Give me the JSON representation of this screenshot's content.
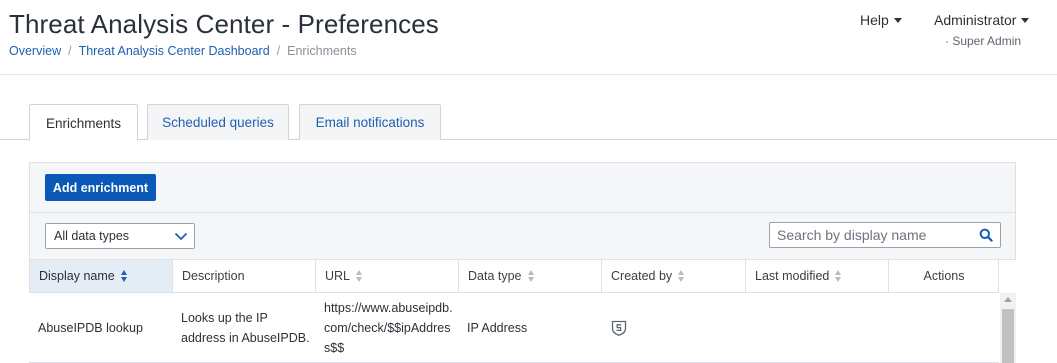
{
  "header": {
    "title": "Threat Analysis Center - Preferences",
    "breadcrumb": [
      "Overview",
      "Threat Analysis Center Dashboard",
      "Enrichments"
    ],
    "help_label": "Help",
    "user_label": "Administrator",
    "user_role": "· Super Admin"
  },
  "tabs": [
    {
      "label": "Enrichments",
      "active": true
    },
    {
      "label": "Scheduled queries",
      "active": false
    },
    {
      "label": "Email notifications",
      "active": false
    }
  ],
  "toolbar": {
    "add_label": "Add enrichment",
    "filter_value": "All data types",
    "search_placeholder": "Search by display name"
  },
  "table": {
    "columns": [
      "Display name",
      "Description",
      "URL",
      "Data type",
      "Created by",
      "Last modified",
      "Actions"
    ],
    "sorted_column": "Display name",
    "rows": [
      {
        "display_name": "AbuseIPDB lookup",
        "description": "Looks up the IP address in AbuseIPDB.",
        "url": "https://www.abuseipdb.com/check/$$ipAddress$$",
        "data_type": "IP Address",
        "created_by_icon": "sophos-shield-icon",
        "last_modified": "",
        "actions": ""
      }
    ]
  },
  "colors": {
    "accent": "#0a59b8",
    "link": "#1f5fb0"
  }
}
